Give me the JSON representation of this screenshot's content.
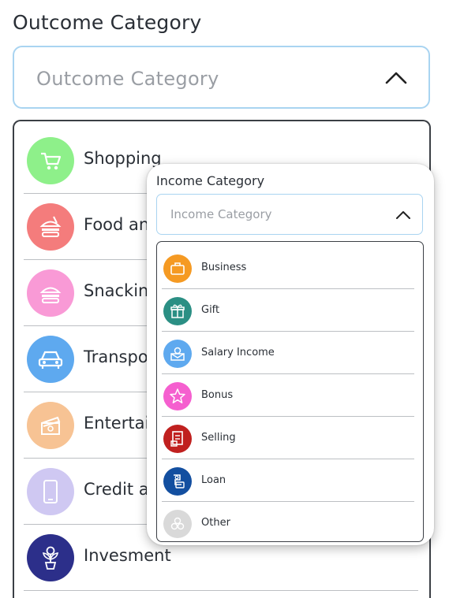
{
  "outcome": {
    "label": "Outcome Category",
    "placeholder": "Outcome Category",
    "items": [
      {
        "label": "Shopping",
        "color": "#8ef08a",
        "icon": "cart-icon"
      },
      {
        "label": "Food and",
        "color": "#f47c7c",
        "icon": "fast-food-icon"
      },
      {
        "label": "Snacking",
        "color": "#f99ad6",
        "icon": "snack-icon"
      },
      {
        "label": "Transpor",
        "color": "#5ea9ef",
        "icon": "car-icon"
      },
      {
        "label": "Entertai",
        "color": "#f7c394",
        "icon": "clapperboard-icon"
      },
      {
        "label": "Credit ar",
        "color": "#cfc8f2",
        "icon": "phone-icon"
      },
      {
        "label": "Invesment",
        "color": "#2c2f8a",
        "icon": "money-plant-icon"
      }
    ]
  },
  "income": {
    "label": "Income Category",
    "placeholder": "Income Category",
    "items": [
      {
        "label": "Business",
        "color": "#f59a23",
        "icon": "briefcase-icon"
      },
      {
        "label": "Gift",
        "color": "#2b8f84",
        "icon": "gift-icon"
      },
      {
        "label": "Salary Income",
        "color": "#5ea9ef",
        "icon": "salary-envelope-icon"
      },
      {
        "label": "Bonus",
        "color": "#f55fcf",
        "icon": "star-icon"
      },
      {
        "label": "Selling",
        "color": "#c0201f",
        "icon": "receipt-icon"
      },
      {
        "label": "Loan",
        "color": "#134fa0",
        "icon": "loan-cash-icon"
      },
      {
        "label": "Other",
        "color": "#d9d9d9",
        "icon": "other-circles-icon"
      }
    ]
  }
}
